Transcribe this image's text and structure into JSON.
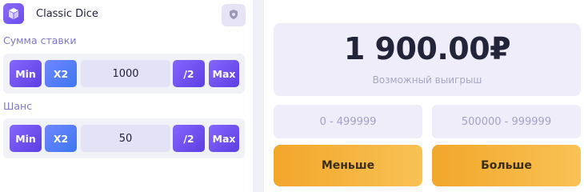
{
  "game": {
    "title": "Classic Dice"
  },
  "bet": {
    "label": "Сумма ставки",
    "min_label": "Min",
    "x2_label": "X2",
    "value": "1000",
    "half_label": "/2",
    "max_label": "Max"
  },
  "chance": {
    "label": "Шанс",
    "min_label": "Min",
    "x2_label": "X2",
    "value": "50",
    "half_label": "/2",
    "max_label": "Max"
  },
  "payout": {
    "amount": "1 900.00₽",
    "label": "Возможный выигрыш"
  },
  "ranges": {
    "low": "0 - 499999",
    "high": "500000 - 999999"
  },
  "actions": {
    "lower_label": "Меньше",
    "higher_label": "Больше"
  },
  "icons": {
    "game": "dice-icon",
    "fairness": "shield-icon"
  },
  "colors": {
    "accent_purple": "#6a4df0",
    "accent_blue": "#3e77ef",
    "action_orange": "#f2a72a"
  }
}
